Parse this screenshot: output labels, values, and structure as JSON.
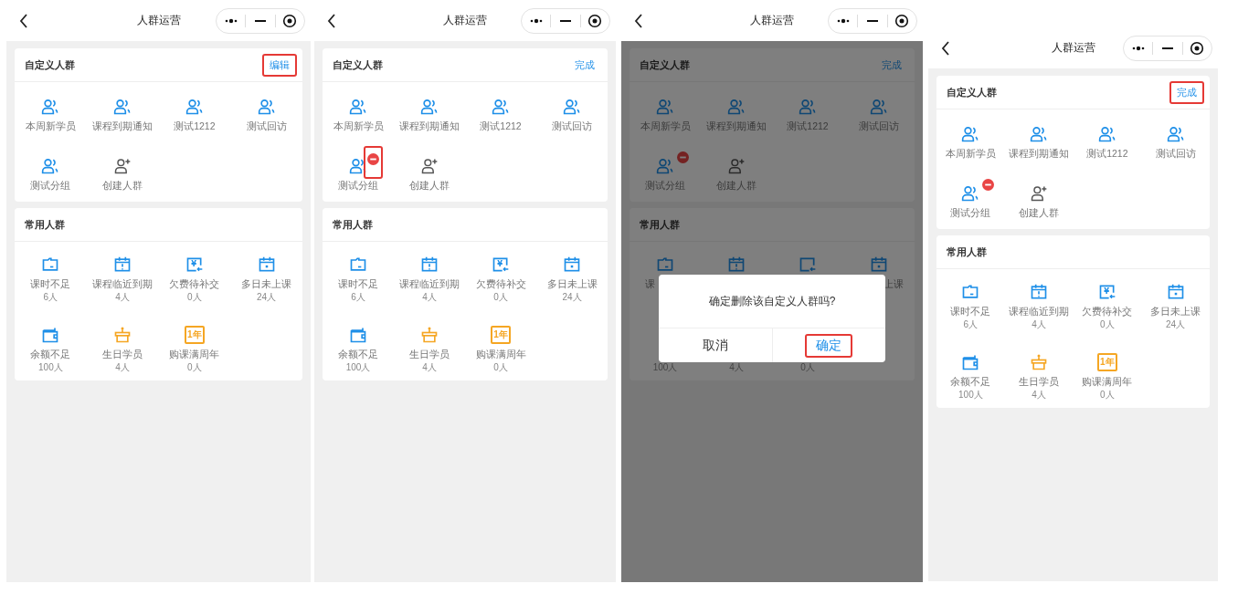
{
  "screens": [
    {
      "nav_title": "人群运营",
      "custom": {
        "title": "自定义人群",
        "action": {
          "label": "编辑",
          "highlighted": true
        },
        "items": [
          {
            "kind": "group",
            "label": "本周新学员",
            "removable": false
          },
          {
            "kind": "group",
            "label": "课程到期通知",
            "removable": false
          },
          {
            "kind": "group",
            "label": "测试1212",
            "removable": false
          },
          {
            "kind": "group",
            "label": "测试回访",
            "removable": false
          },
          {
            "kind": "group",
            "label": "测试分组",
            "removable": false
          },
          {
            "kind": "create",
            "label": "创建人群"
          }
        ]
      },
      "common": {
        "title": "常用人群",
        "items": [
          {
            "color": "#1e8fe8",
            "label": "课时不足",
            "count": "6人"
          },
          {
            "color": "#1e8fe8",
            "label": "课程临近到期",
            "count": "4人"
          },
          {
            "icon_text": "¥",
            "color": "#1e8fe8",
            "label": "欠费待补交",
            "count": "0人"
          },
          {
            "color": "#1e8fe8",
            "label": "多日未上课",
            "count": "24人"
          },
          {
            "color": "#1e8fe8",
            "label": "余额不足",
            "count": "100人"
          },
          {
            "color": "#f5a623",
            "label": "生日学员",
            "count": "4人"
          },
          {
            "icon_text": "1年",
            "color": "#f5a623",
            "label": "购课满周年",
            "count": "0人"
          }
        ]
      }
    },
    {
      "nav_title": "人群运营",
      "custom": {
        "title": "自定义人群",
        "action": {
          "label": "完成",
          "highlighted": false
        },
        "items": [
          {
            "kind": "group",
            "label": "本周新学员",
            "removable": false
          },
          {
            "kind": "group",
            "label": "课程到期通知",
            "removable": false
          },
          {
            "kind": "group",
            "label": "测试1212",
            "removable": false
          },
          {
            "kind": "group",
            "label": "测试回访",
            "removable": false
          },
          {
            "kind": "group",
            "label": "测试分组",
            "removable": true,
            "highlighted": true
          },
          {
            "kind": "create",
            "label": "创建人群"
          }
        ]
      },
      "common": {
        "title": "常用人群",
        "items": [
          {
            "color": "#1e8fe8",
            "label": "课时不足",
            "count": "6人"
          },
          {
            "color": "#1e8fe8",
            "label": "课程临近到期",
            "count": "4人"
          },
          {
            "icon_text": "¥",
            "color": "#1e8fe8",
            "label": "欠费待补交",
            "count": "0人"
          },
          {
            "color": "#1e8fe8",
            "label": "多日未上课",
            "count": "24人"
          },
          {
            "color": "#1e8fe8",
            "label": "余额不足",
            "count": "100人"
          },
          {
            "color": "#f5a623",
            "label": "生日学员",
            "count": "4人"
          },
          {
            "icon_text": "1年",
            "color": "#f5a623",
            "label": "购课满周年",
            "count": "0人"
          }
        ]
      }
    },
    {
      "nav_title": "人群运营",
      "custom": {
        "title": "自定义人群",
        "action": {
          "label": "完成",
          "highlighted": false
        },
        "items": [
          {
            "kind": "group",
            "label": "本周新学员",
            "removable": false
          },
          {
            "kind": "group",
            "label": "课程到期通知",
            "removable": false
          },
          {
            "kind": "group",
            "label": "测试1212",
            "removable": false
          },
          {
            "kind": "group",
            "label": "测试回访",
            "removable": false
          },
          {
            "kind": "group",
            "label": "测试分组",
            "removable": true,
            "highlighted": false
          },
          {
            "kind": "create",
            "label": "创建人群"
          }
        ]
      },
      "common": {
        "title": "常用人群",
        "items": [
          {
            "color": "#0f4774",
            "label": "课"
          },
          {
            "color": "#0f4774"
          },
          {
            "color": "#0f4774"
          },
          {
            "color": "#0f4774",
            "label": "上课"
          },
          {
            "count": "100人"
          },
          {
            "count": "4人"
          },
          {
            "count": "0人"
          }
        ]
      },
      "dialog": {
        "message": "确定删除该自定义人群吗?",
        "buttons": [
          {
            "kind": "cancel",
            "label": "取消",
            "highlighted": false
          },
          {
            "kind": "confirm",
            "label": "确定",
            "highlighted": true
          }
        ]
      }
    },
    {
      "nav_title": "人群运营",
      "custom": {
        "title": "自定义人群",
        "action": {
          "label": "完成",
          "highlighted": true
        },
        "items": [
          {
            "kind": "group",
            "label": "本周新学员",
            "removable": false
          },
          {
            "kind": "group",
            "label": "课程到期通知",
            "removable": false
          },
          {
            "kind": "group",
            "label": "测试1212",
            "removable": false
          },
          {
            "kind": "group",
            "label": "测试回访",
            "removable": false
          },
          {
            "kind": "group",
            "label": "测试分组",
            "removable": true,
            "highlighted": false
          },
          {
            "kind": "create",
            "label": "创建人群"
          }
        ]
      },
      "common": {
        "title": "常用人群",
        "items": [
          {
            "color": "#1e8fe8",
            "label": "课时不足",
            "count": "6人"
          },
          {
            "color": "#1e8fe8",
            "label": "课程临近到期",
            "count": "4人"
          },
          {
            "icon_text": "¥",
            "color": "#1e8fe8",
            "label": "欠费待补交",
            "count": "0人"
          },
          {
            "color": "#1e8fe8",
            "label": "多日未上课",
            "count": "24人"
          },
          {
            "color": "#1e8fe8",
            "label": "余额不足",
            "count": "100人"
          },
          {
            "color": "#f5a623",
            "label": "生日学员",
            "count": "4人"
          },
          {
            "icon_text": "1年",
            "color": "#f5a623",
            "label": "购课满周年",
            "count": "0人"
          }
        ]
      }
    }
  ]
}
